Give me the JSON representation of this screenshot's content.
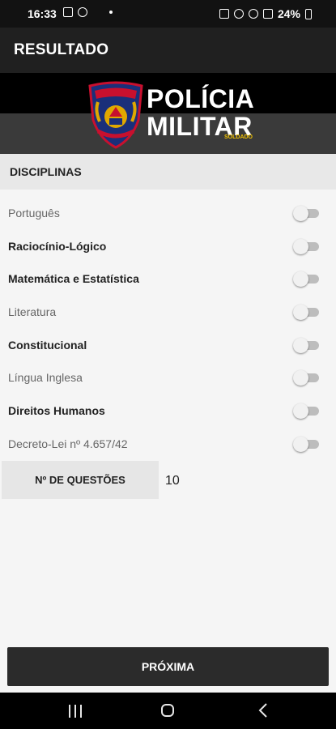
{
  "status_bar": {
    "time": "16:33",
    "battery": "24%"
  },
  "app_bar": {
    "title": "RESULTADO"
  },
  "banner": {
    "brand_line1": "POLÍCIA",
    "brand_line2": "MILITAR",
    "brand_sub": "SOLDADO"
  },
  "section": {
    "title": "DISCIPLINAS"
  },
  "subjects": [
    {
      "label": "Português",
      "enabled": false,
      "bold": false
    },
    {
      "label": "Raciocínio-Lógico",
      "enabled": false,
      "bold": true
    },
    {
      "label": "Matemática e Estatística",
      "enabled": false,
      "bold": true
    },
    {
      "label": "Literatura",
      "enabled": false,
      "bold": false
    },
    {
      "label": "Constitucional",
      "enabled": false,
      "bold": true
    },
    {
      "label": "Língua Inglesa",
      "enabled": false,
      "bold": false
    },
    {
      "label": "Direitos Humanos",
      "enabled": false,
      "bold": true
    },
    {
      "label": "Decreto-Lei nº 4.657/42",
      "enabled": false,
      "bold": false
    }
  ],
  "questions": {
    "label": "Nº DE QUESTÕES",
    "value": "10"
  },
  "next_button": {
    "label": "PRÓXIMA"
  },
  "colors": {
    "app_bar": "#202020",
    "switch_off_track": "#bdbdbd",
    "brand_sub": "#f2c200"
  }
}
